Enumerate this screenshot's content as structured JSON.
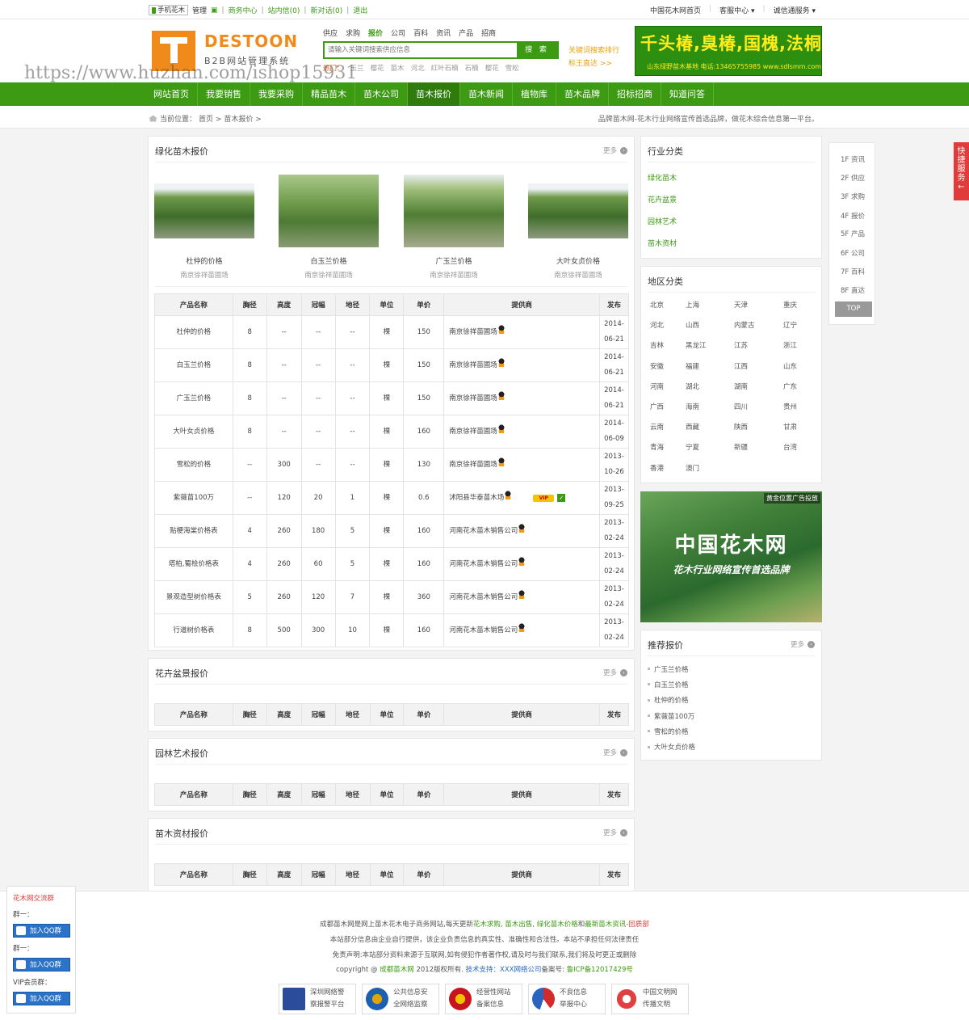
{
  "topbar": {
    "mobile": "手机花木",
    "manage": "管理",
    "links": [
      "商务中心",
      "站内信(0)",
      "新对话(0)",
      "退出"
    ],
    "right": [
      "中国花木网首页",
      "客服中心",
      "诚信通服务"
    ]
  },
  "logo": {
    "name": "DESTOON",
    "sub": "B2B网站管理系统"
  },
  "search": {
    "tabs": [
      "供应",
      "求购",
      "报价",
      "公司",
      "百科",
      "资讯",
      "产品",
      "招商"
    ],
    "active_tab": "报价",
    "placeholder": "请输入关键词搜索供应信息",
    "button": "搜 索",
    "hot_label": "热门：",
    "hot": [
      "玉兰",
      "樱花",
      "苗木",
      "河北",
      "红叶石楠",
      "石楠",
      "樱花",
      "雪松"
    ],
    "kw1": "关键词搜索排行",
    "kw2": "标王直达 >>"
  },
  "top_ad": {
    "line1": "千头椿,臭椿,国槐,法桐",
    "line2": "山东绿野苗木基地  电话:13465755985 www.sdlsmm.com"
  },
  "watermark": "https://www.huzhan.com/ishop15931",
  "nav": [
    "网站首页",
    "我要销售",
    "我要采购",
    "精品苗木",
    "苗木公司",
    "苗木报价",
    "苗木新闻",
    "植物库",
    "苗木品牌",
    "招标招商",
    "知道问答"
  ],
  "nav_active": 5,
  "crumb": {
    "label": "当前位置：",
    "home": "首页 >",
    "cur": "苗木报价 >",
    "slogan": "品牌苗木网-花木行业网络宣传首选品牌，做花木综合信息第一平台。"
  },
  "section1": {
    "title": "绿化苗木报价",
    "more": "更多",
    "products": [
      {
        "name": "杜仲的价格",
        "supplier": "南京徐祥苗圃场"
      },
      {
        "name": "白玉兰价格",
        "supplier": "南京徐祥苗圃场"
      },
      {
        "name": "广玉兰价格",
        "supplier": "南京徐祥苗圃场"
      },
      {
        "name": "大叶女贞价格",
        "supplier": "南京徐祥苗圃场"
      }
    ],
    "headers": [
      "产品名称",
      "胸径",
      "高度",
      "冠幅",
      "地径",
      "单位",
      "单价",
      "提供商",
      "发布"
    ],
    "rows": [
      {
        "name": "杜仲的价格",
        "d": "8",
        "h": "--",
        "c": "--",
        "g": "--",
        "u": "棵",
        "p": "150",
        "s": "南京徐祥苗圃场",
        "t1": "2014-",
        "t2": "06-21"
      },
      {
        "name": "白玉兰价格",
        "d": "8",
        "h": "--",
        "c": "--",
        "g": "--",
        "u": "棵",
        "p": "150",
        "s": "南京徐祥苗圃场",
        "t1": "2014-",
        "t2": "06-21"
      },
      {
        "name": "广玉兰价格",
        "d": "8",
        "h": "--",
        "c": "--",
        "g": "--",
        "u": "棵",
        "p": "150",
        "s": "南京徐祥苗圃场",
        "t1": "2014-",
        "t2": "06-21"
      },
      {
        "name": "大叶女贞价格",
        "d": "8",
        "h": "--",
        "c": "--",
        "g": "--",
        "u": "棵",
        "p": "160",
        "s": "南京徐祥苗圃场",
        "t1": "2014-",
        "t2": "06-09"
      },
      {
        "name": "雪松的价格",
        "d": "--",
        "h": "300",
        "c": "--",
        "g": "--",
        "u": "棵",
        "p": "130",
        "s": "南京徐祥苗圃场",
        "t1": "2013-",
        "t2": "10-26"
      },
      {
        "name": "紫薇苗100万",
        "d": "--",
        "h": "120",
        "c": "20",
        "g": "1",
        "u": "棵",
        "p": "0.6",
        "s": "沭阳县华泰苗木场",
        "t1": "2013-",
        "t2": "09-25",
        "vip": "VIP"
      },
      {
        "name": "贴梗海棠价格表",
        "d": "4",
        "h": "260",
        "c": "180",
        "g": "5",
        "u": "棵",
        "p": "160",
        "s": "河南花木苗木销售公司",
        "t1": "2013-",
        "t2": "02-24"
      },
      {
        "name": "塔柏,蜀桧价格表",
        "d": "4",
        "h": "260",
        "c": "60",
        "g": "5",
        "u": "棵",
        "p": "160",
        "s": "河南花木苗木销售公司",
        "t1": "2013-",
        "t2": "02-24"
      },
      {
        "name": "景观造型树价格表",
        "d": "5",
        "h": "260",
        "c": "120",
        "g": "7",
        "u": "棵",
        "p": "360",
        "s": "河南花木苗木销售公司",
        "t1": "2013-",
        "t2": "02-24"
      },
      {
        "name": "行道树价格表",
        "d": "8",
        "h": "500",
        "c": "300",
        "g": "10",
        "u": "棵",
        "p": "160",
        "s": "河南花木苗木销售公司",
        "t1": "2013-",
        "t2": "02-24"
      }
    ]
  },
  "section2": {
    "title": "花卉盆景报价",
    "more": "更多"
  },
  "section3": {
    "title": "园林艺术报价",
    "more": "更多"
  },
  "section4": {
    "title": "苗木资材报价",
    "more": "更多"
  },
  "side_cat": {
    "title": "行业分类",
    "items": [
      "绿化苗木",
      "花卉盆景",
      "园林艺术",
      "苗木资材"
    ]
  },
  "side_region": {
    "title": "地区分类",
    "items": [
      "北京",
      "上海",
      "天津",
      "重庆",
      "河北",
      "山西",
      "内蒙古",
      "辽宁",
      "吉林",
      "黑龙江",
      "江苏",
      "浙江",
      "安徽",
      "福建",
      "江西",
      "山东",
      "河南",
      "湖北",
      "湖南",
      "广东",
      "广西",
      "海南",
      "四川",
      "贵州",
      "云南",
      "西藏",
      "陕西",
      "甘肃",
      "青海",
      "宁夏",
      "新疆",
      "台湾",
      "香港",
      "澳门"
    ]
  },
  "big_ad": {
    "tag": "黄金位置广告投放",
    "h1": "中国花木网",
    "h2": "花木行业网络宣传首选品牌"
  },
  "side_rec": {
    "title": "推荐报价",
    "more": "更多",
    "items": [
      "广玉兰价格",
      "白玉兰价格",
      "杜仲的价格",
      "紫薇苗100万",
      "雪松的价格",
      "大叶女贞价格"
    ]
  },
  "floors": [
    "1F 资讯",
    "2F 供应",
    "3F 求购",
    "4F 报价",
    "5F 产品",
    "6F 公司",
    "7F 百科",
    "8F 直达",
    "TOP"
  ],
  "quick": "快捷服务",
  "qqpanel": {
    "title": "花木网交流群",
    "groups": [
      "群一：",
      "群一：",
      "VIP会员群："
    ],
    "btn": "加入QQ群"
  },
  "footer": {
    "l1a": "成都苗木网是网上苗木花木电子商务网站,每天更新",
    "l1b": "花木求购",
    "l1c": "苗木出售",
    "l1d": "绿化苗木价格",
    "l1e": "和",
    "l1f": "最新苗木资讯",
    "l1g": "-回质部",
    "l2": "本站部分信息由企业自行提供，该企业负责信息的真实性、准确性和合法性。本站不承担任何法律责任",
    "l3": "免责声明:本站部分资料来源于互联网,如有侵犯作者著作权,请及时与我们联系,我们将及时更正或删除",
    "l4a": "copyright @ ",
    "l4b": "成都苗木网",
    "l4c": " 2012版权所有. ",
    "l4d": "技术支持：",
    "l4e": "XXX网络公司",
    "l4f": "备案号: ",
    "l4g": "鲁ICP备12017429号",
    "badges": [
      {
        "a": "深圳网络警",
        "b": "察报警平台"
      },
      {
        "a": "公共信息安",
        "b": "全网络监察"
      },
      {
        "a": "经营性网站",
        "b": "备案信息"
      },
      {
        "a": "不良信息",
        "b": "举报中心"
      },
      {
        "a": "中国文明网",
        "b": "传播文明"
      }
    ]
  }
}
